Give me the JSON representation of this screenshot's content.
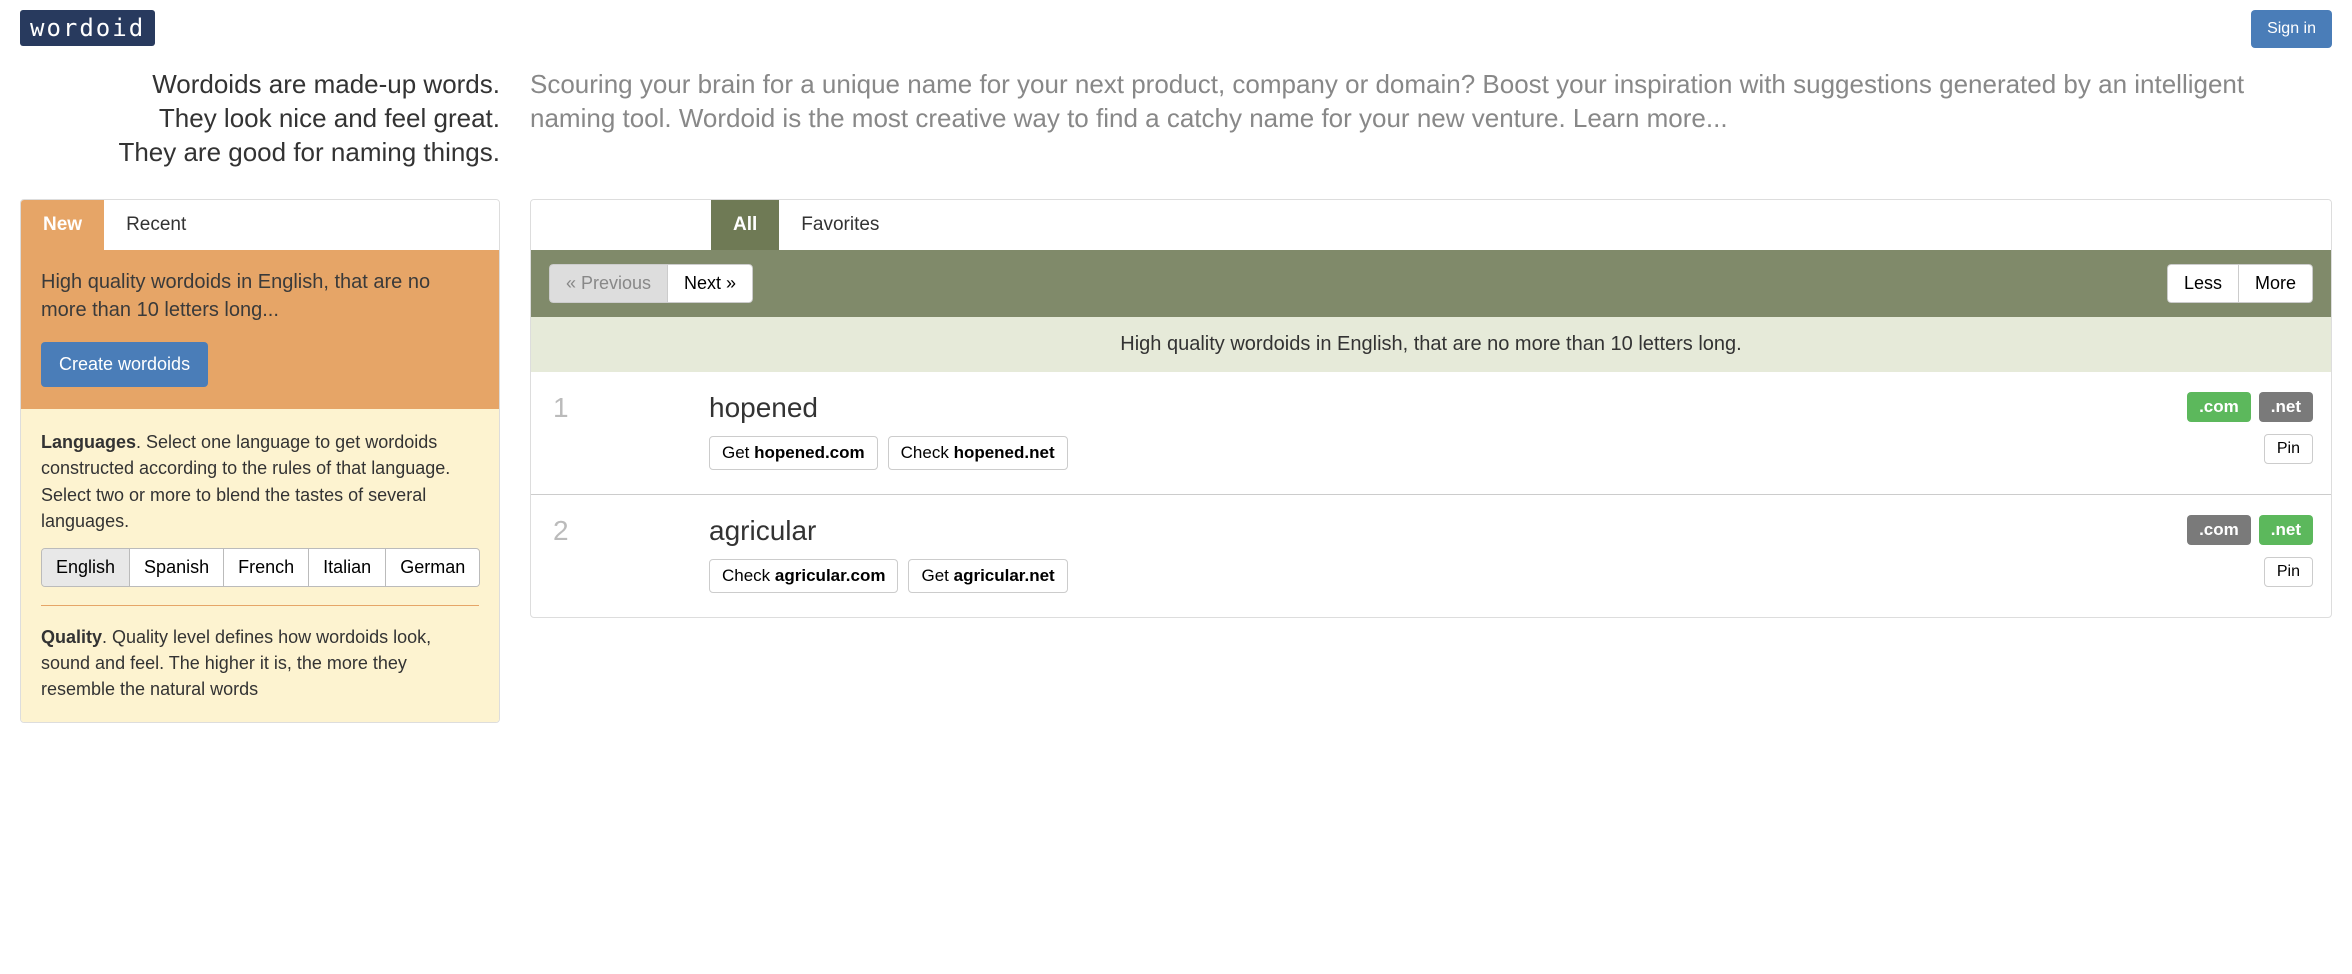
{
  "header": {
    "logo": "wordoid",
    "signin": "Sign in"
  },
  "tagline": {
    "line1": "Wordoids are made-up words.",
    "line2": "They look nice and feel great.",
    "line3": "They are good for naming things."
  },
  "description": {
    "text": "Scouring your brain for a unique name for your next product, company or domain? Boost your inspiration with suggestions generated by an intelligent naming tool. Wordoid is the most creative way to find a catchy name for your new venture. ",
    "learn_more": "Learn more..."
  },
  "sidebar": {
    "tabs": {
      "new": "New",
      "recent": "Recent"
    },
    "summary": "High quality wordoids in English, that are no more than 10 letters long...",
    "create_button": "Create wordoids",
    "languages": {
      "title": "Languages",
      "text": ". Select one language to get wordoids constructed according to the rules of that language. Select two or more to blend the tastes of several languages.",
      "options": [
        "English",
        "Spanish",
        "French",
        "Italian",
        "German"
      ],
      "active": "English"
    },
    "quality": {
      "title": "Quality",
      "text": ". Quality level defines how wordoids look, sound and feel. The higher it is, the more they resemble the natural words"
    }
  },
  "results": {
    "tabs": {
      "all": "All",
      "favorites": "Favorites"
    },
    "pagination": {
      "previous": "« Previous",
      "next": "Next »"
    },
    "lessmore": {
      "less": "Less",
      "more": "More"
    },
    "summary": "High quality wordoids in English, that are no more than 10 letters long.",
    "pin_label": "Pin",
    "items": [
      {
        "num": "1",
        "word": "hopened",
        "domain_buttons": [
          {
            "prefix": "Get ",
            "domain": "hopened.com"
          },
          {
            "prefix": "Check ",
            "domain": "hopened.net"
          }
        ],
        "badges": [
          {
            "text": ".com",
            "class": "green"
          },
          {
            "text": ".net",
            "class": "grey"
          }
        ]
      },
      {
        "num": "2",
        "word": "agricular",
        "domain_buttons": [
          {
            "prefix": "Check ",
            "domain": "agricular.com"
          },
          {
            "prefix": "Get ",
            "domain": "agricular.net"
          }
        ],
        "badges": [
          {
            "text": ".com",
            "class": "grey"
          },
          {
            "text": ".net",
            "class": "green"
          }
        ]
      }
    ]
  }
}
